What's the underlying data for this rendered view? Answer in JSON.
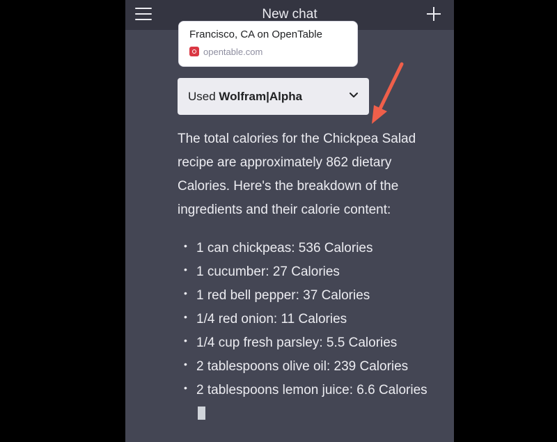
{
  "header": {
    "title": "New chat",
    "menu_icon": "hamburger-menu-icon",
    "new_chat_icon": "plus-icon"
  },
  "link_card": {
    "title": "Francisco, CA on OpenTable",
    "domain": "opentable.com",
    "favicon": "opentable-icon",
    "favicon_color": "#da3743"
  },
  "plugin": {
    "prefix": "Used ",
    "name": "Wolfram|Alpha",
    "toggle_icon": "chevron-down-icon"
  },
  "answer": {
    "intro": "The total calories for the Chickpea Salad recipe are approximately 862 dietary Calories. Here's the breakdown of the ingredients and their calorie content:",
    "ingredients": [
      "1 can chickpeas: 536 Calories",
      "1 cucumber: 27 Calories",
      "1 red bell pepper: 37 Calories",
      "1/4 red onion: 11 Calories",
      "1/4 cup fresh parsley: 5.5 Calories",
      "2 tablespoons olive oil: 239 Calories",
      "2 tablespoons lemon juice: 6.6 Calories"
    ],
    "bullet": "•"
  },
  "annotation": {
    "arrow_color": "#ef5f4a"
  },
  "colors": {
    "background": "#000000",
    "chat_bg": "#444654",
    "header_bg": "#343541",
    "text": "#ececf1"
  }
}
